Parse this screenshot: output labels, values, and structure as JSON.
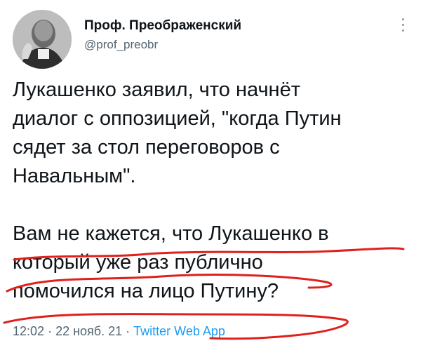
{
  "author": {
    "name": "Проф. Преображенский",
    "handle": "@prof_preobr",
    "avatar_icon": "profile-photo-icon"
  },
  "more_icon": "more-vertical-icon",
  "tweet": {
    "paragraph1": [
      "Лукашенко заявил, что начнёт",
      "диалог с оппозицией, \"когда Путин",
      "сядет за стол переговоров с",
      "Навальным\"."
    ],
    "paragraph2": [
      "Вам не кажется, что Лукашенко в",
      "который уже раз публично",
      "помочился на лицо Путину?"
    ]
  },
  "meta": {
    "time": "12:02",
    "separator": "·",
    "date": "22 нояб. 21",
    "app": "Twitter Web App"
  },
  "colors": {
    "text": "#0f1419",
    "secondary": "#536471",
    "link": "#1d9bf0",
    "annotation": "#e0201d"
  }
}
